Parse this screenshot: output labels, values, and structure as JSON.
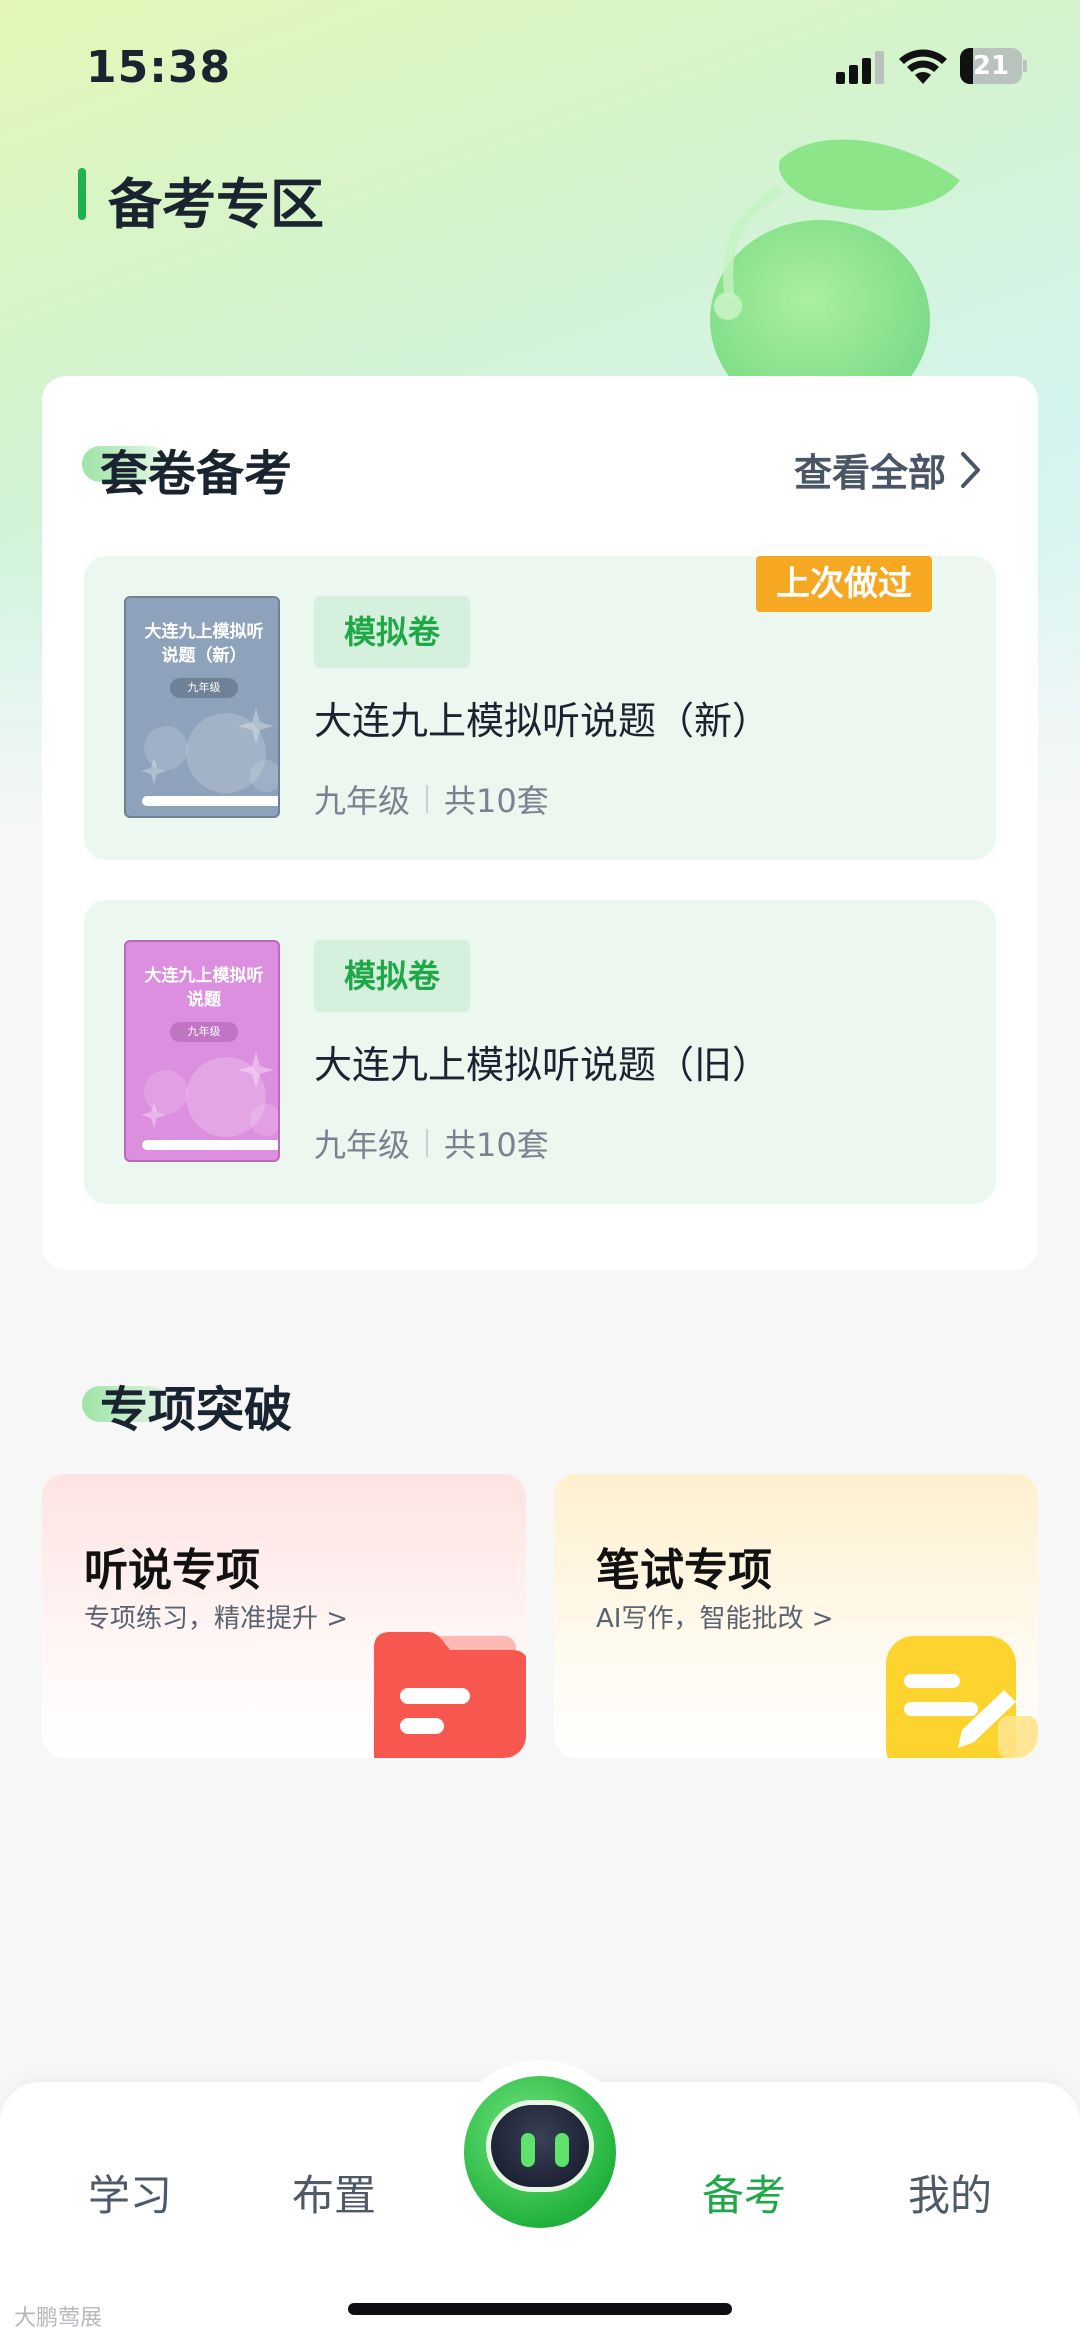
{
  "status_bar": {
    "time": "15:38",
    "battery": "21"
  },
  "header": {
    "title": "备考专区"
  },
  "paper_section": {
    "title": "套卷备考",
    "view_all": "查看全部",
    "items": [
      {
        "tag": "模拟卷",
        "title": "大连九上模拟听说题（新）",
        "grade": "九年级",
        "count": "共10套",
        "badge": "上次做过",
        "cover_title": "大连九上模拟听说题（新）",
        "cover_grade": "九年级",
        "cover_color": "#8ea3bb"
      },
      {
        "tag": "模拟卷",
        "title": "大连九上模拟听说题（旧）",
        "grade": "九年级",
        "count": "共10套",
        "cover_title": "大连九上模拟听说题",
        "cover_grade": "九年级",
        "cover_color": "#dd8fdf"
      }
    ]
  },
  "special_section": {
    "title": "专项突破",
    "cards": [
      {
        "title": "听说专项",
        "subtitle": "专项练习，精准提升 >"
      },
      {
        "title": "笔试专项",
        "subtitle": "AI写作，智能批改 >"
      }
    ]
  },
  "bottom_nav": {
    "items": [
      {
        "label": "学习"
      },
      {
        "label": "布置"
      },
      {
        "label": "备考",
        "active": true
      },
      {
        "label": "我的"
      }
    ]
  },
  "watermark": "大鹏莺展",
  "colors": {
    "accent": "#1fa847",
    "badge": "#f7a823"
  }
}
